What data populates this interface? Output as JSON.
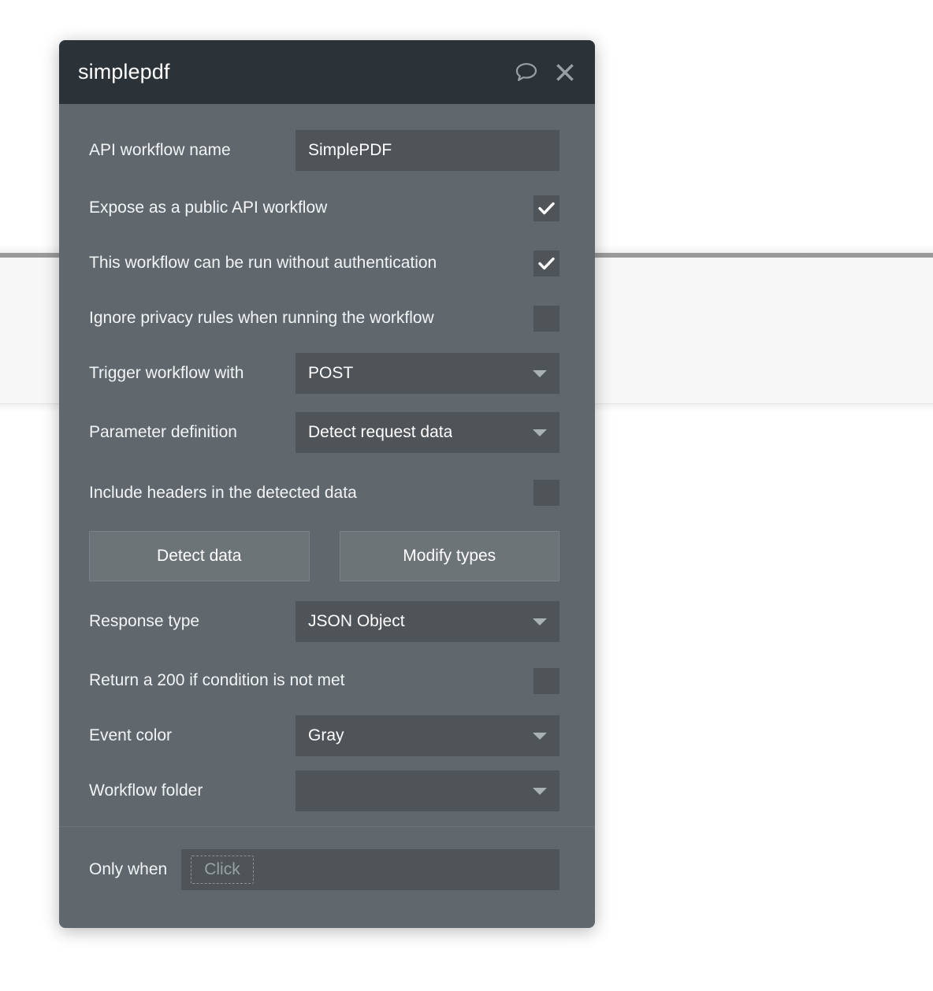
{
  "header": {
    "title": "simplepdf",
    "comment_icon": "comment-bubble-icon",
    "close_icon": "close-icon"
  },
  "form": {
    "api_workflow_name": {
      "label": "API workflow name",
      "value": "SimplePDF"
    },
    "expose_public": {
      "label": "Expose as a public API workflow",
      "checked": true
    },
    "run_without_auth": {
      "label": "This workflow can be run without authentication",
      "checked": true
    },
    "ignore_privacy_rules": {
      "label": "Ignore privacy rules when running the workflow",
      "checked": false
    },
    "trigger_workflow_with": {
      "label": "Trigger workflow with",
      "value": "POST"
    },
    "parameter_definition": {
      "label": "Parameter definition",
      "value": "Detect request data"
    },
    "include_headers": {
      "label": "Include headers in the detected data",
      "checked": false
    },
    "detect_data_button": "Detect data",
    "modify_types_button": "Modify types",
    "response_type": {
      "label": "Response type",
      "value": "JSON Object"
    },
    "return_200": {
      "label": "Return a 200 if condition is not met",
      "checked": false
    },
    "event_color": {
      "label": "Event color",
      "value": "Gray"
    },
    "workflow_folder": {
      "label": "Workflow folder",
      "value": ""
    }
  },
  "footer": {
    "only_when_label": "Only when",
    "only_when_placeholder": "Click"
  },
  "colors": {
    "modal_body": "#60686d",
    "modal_header": "#2b3338",
    "field": "#4e5458",
    "button": "#6c7478",
    "text": "#ffffff",
    "icon": "#98a0a5",
    "page_band": "#f7f7f7",
    "page_rule": "#9a9a9a"
  }
}
